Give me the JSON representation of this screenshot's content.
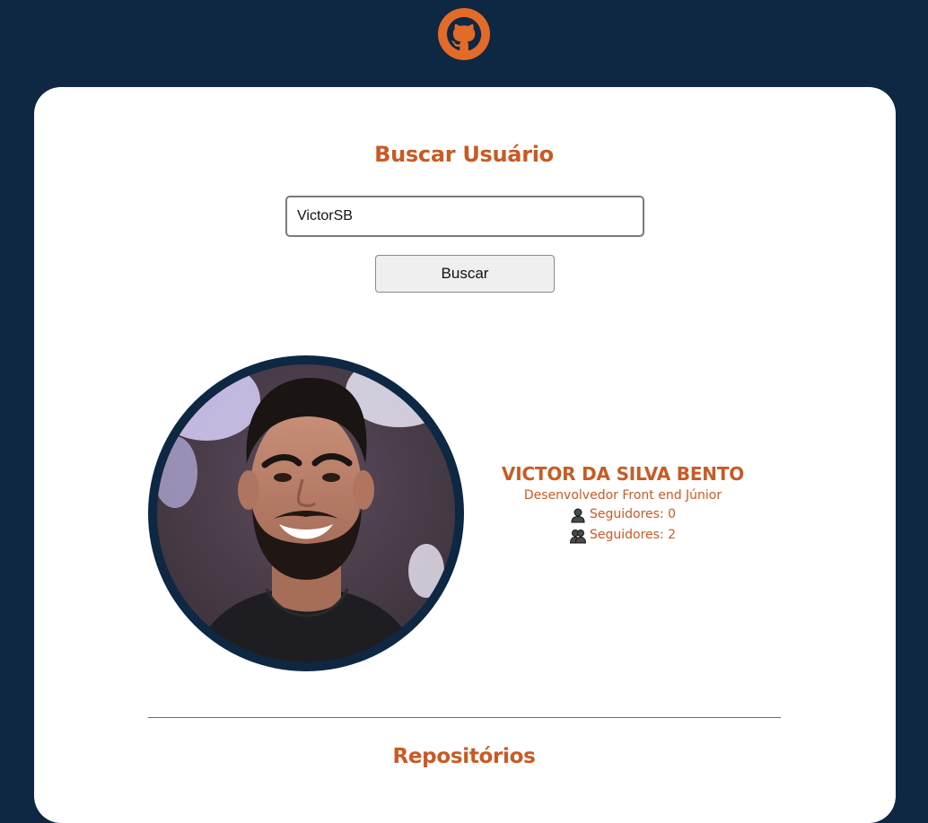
{
  "header": {
    "logo_icon": "github-icon",
    "logo_color": "#e26b28",
    "background_color": "#0e2742"
  },
  "search": {
    "title": "Buscar Usuário",
    "input_value": "VictorSB",
    "button_label": "Buscar"
  },
  "profile": {
    "avatar_icon": "profile-photo",
    "name": "VICTOR DA SILVA BENTO",
    "bio": "Desenvolvedor Front end Júnior",
    "following_label": "Seguidores: 0",
    "following_icon": "user-icon",
    "followers_label": "Seguidores: 2",
    "followers_icon": "users-icon"
  },
  "repositories": {
    "title": "Repositórios"
  },
  "colors": {
    "accent": "#c95a24",
    "navy": "#0e2742",
    "card": "#ffffff"
  }
}
